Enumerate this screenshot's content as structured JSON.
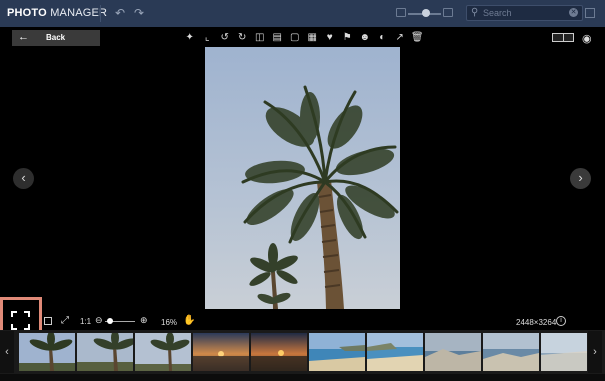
{
  "app": {
    "title_bold": "PHOTO",
    "title_light": "MANAGER"
  },
  "search": {
    "placeholder": "Search"
  },
  "toolbar": {
    "back_label": "Back",
    "tools": [
      "magic-wand",
      "crop",
      "rotate-left",
      "rotate-right",
      "flip-horizontal",
      "flip-vertical",
      "resize",
      "adjust",
      "favorite-heart",
      "tag",
      "people",
      "color",
      "share",
      "delete"
    ]
  },
  "viewer": {
    "zoom_ratio_label": "1:1",
    "zoom_percent": "16%",
    "zoom_level": 0.16,
    "dimensions": "2448×3264"
  },
  "thumbnails": [
    {
      "scene": "palm"
    },
    {
      "scene": "palm"
    },
    {
      "scene": "palm"
    },
    {
      "scene": "sunset"
    },
    {
      "scene": "sunset"
    },
    {
      "scene": "beach"
    },
    {
      "scene": "beach"
    },
    {
      "scene": "rocks"
    },
    {
      "scene": "rocks"
    },
    {
      "scene": "coast"
    }
  ],
  "colors": {
    "titlebar": "#2a3a55",
    "highlight": "#e08a78",
    "sky": "#a9bcd3"
  }
}
